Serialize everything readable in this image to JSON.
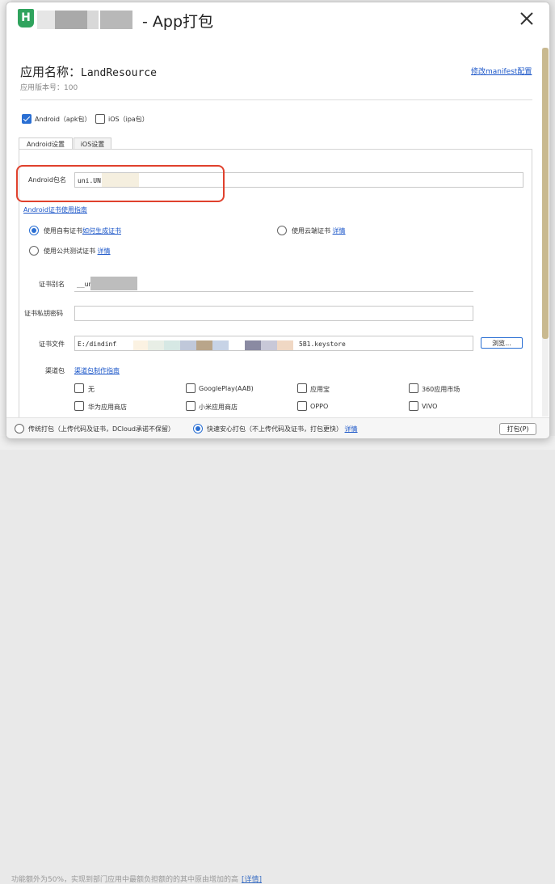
{
  "background": {
    "bottom_text": "功能额外为50%，实现到部门应用中最额负担额的的其中原由增加的高",
    "bottom_link": "[详情]"
  },
  "title": {
    "logo": "H",
    "text": "- App打包",
    "close_icon": "close-icon"
  },
  "app": {
    "name_label": "应用名称：",
    "name_value": "LandResource",
    "version": "应用版本号：100",
    "manifest_link": "修改manifest配置"
  },
  "platforms": {
    "android_label": "Android（apk包）",
    "android_checked": true,
    "ios_label": "iOS（ipa包）",
    "ios_checked": false
  },
  "tabs": [
    {
      "label": "Android设置",
      "active": true
    },
    {
      "label": "iOS设置",
      "active": false
    }
  ],
  "android": {
    "package_label": "Android包名",
    "package_value": "uni.UN",
    "cert_guide_link": "Android证书使用指南",
    "cert_options": [
      {
        "label": "使用自有证书",
        "link": "如何生成证书",
        "selected": true
      },
      {
        "label": "使用云端证书",
        "link": "详情",
        "selected": false
      },
      {
        "label": "使用公共测试证书",
        "link": "详情",
        "selected": false
      }
    ],
    "alias_label": "证书别名",
    "alias_value": "__un",
    "password_label": "证书私钥密码",
    "password_value": "",
    "file_label": "证书文件",
    "file_value_prefix": "E:/dindinfi",
    "file_value_suffix": "5B1.keystore",
    "browse_label": "浏览...",
    "channel_label": "渠道包",
    "channel_link": "渠道包制作指南",
    "channels": [
      "无",
      "GooglePlay(AAB)",
      "应用宝",
      "360应用市场",
      "华为应用商店",
      "小米应用商店",
      "OPPO",
      "VIVO"
    ]
  },
  "footer": {
    "traditional_label": "传统打包（上传代码及证书，DCloud承诺不保留）",
    "traditional_selected": false,
    "secure_label": "快速安心打包（不上传代码及证书，打包更快）",
    "secure_selected": true,
    "secure_link": "详情",
    "pack_button": "打包(P)"
  },
  "colors": {
    "accent": "#2a6fd3",
    "link": "#1a55c8",
    "highlight_box": "#e0412d",
    "logo": "#2fa35d"
  }
}
